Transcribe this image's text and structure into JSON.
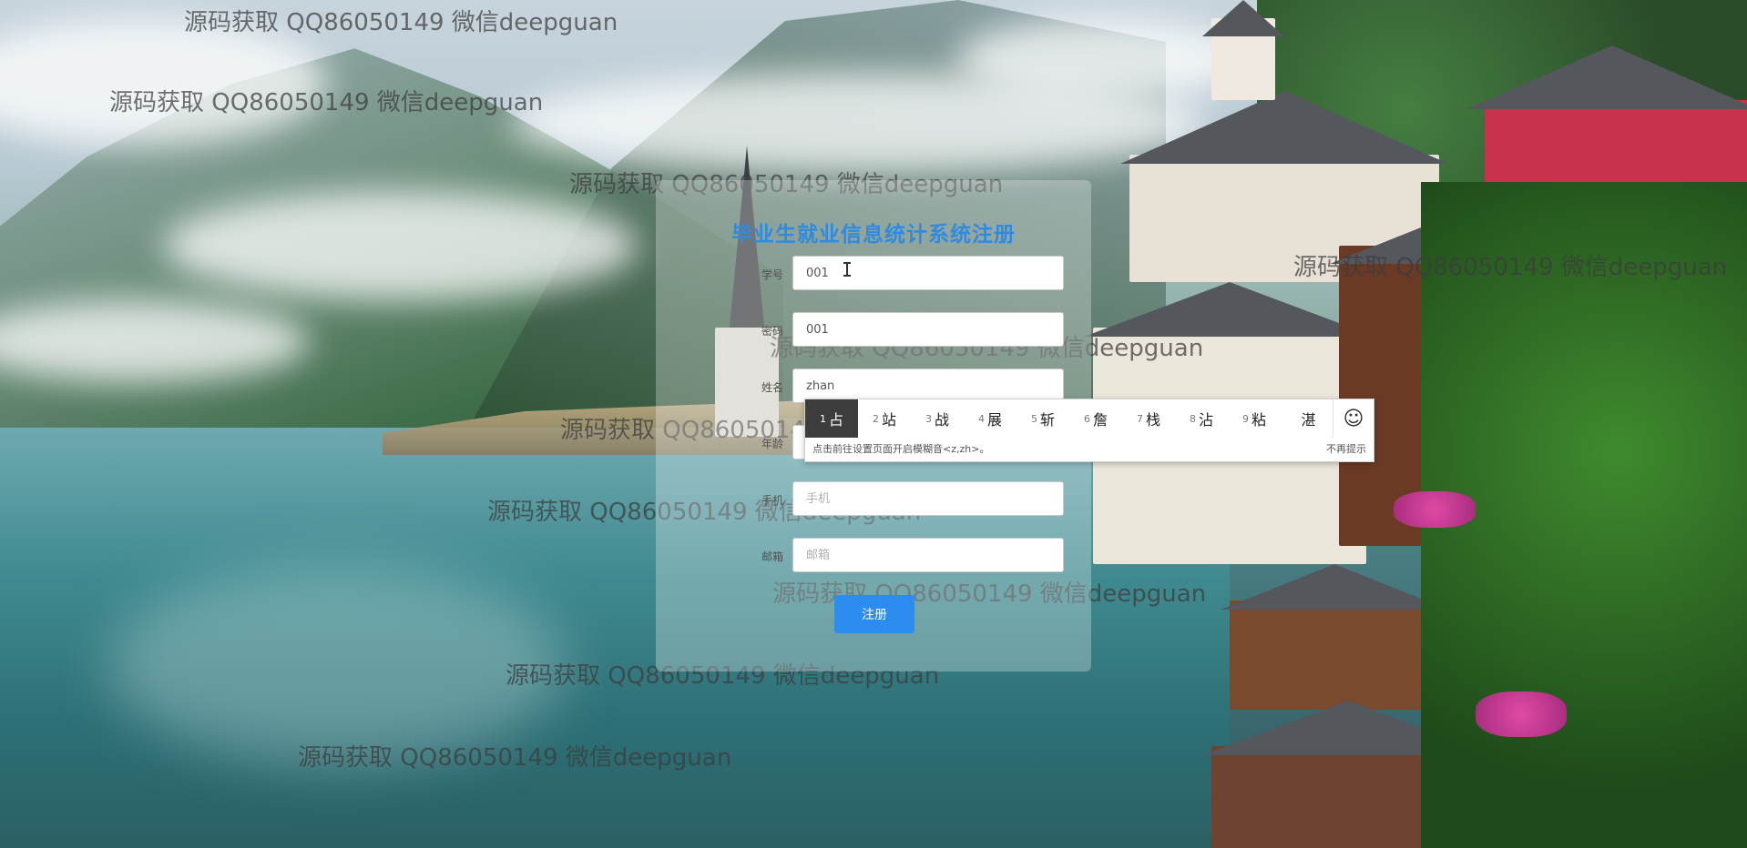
{
  "watermarks": [
    "源码获取 QQ86050149 微信deepguan",
    "源码获取 QQ86050149 微信deepguan",
    "源码获取 QQ86050149 微信deepguan",
    "源码获取 QQ86050149 微信deepguan",
    "源码获取 QQ86050149 微信deepguan",
    "源码获取 QQ86050149 微信deepguan",
    "源码获取 QQ86050149 微信deepguan",
    "源码获取 QQ86050149 微信deepguan",
    "源码获取 QQ86050149 微信deepguan",
    "源码获取 QQ86050149 微信deepguan"
  ],
  "form": {
    "title": "毕业生就业信息统计系统注册",
    "fields": [
      {
        "label": "学号",
        "value": "001",
        "placeholder": ""
      },
      {
        "label": "密码",
        "value": "001",
        "placeholder": ""
      },
      {
        "label": "姓名",
        "value": "zhan",
        "placeholder": ""
      },
      {
        "label": "年龄",
        "value": "",
        "placeholder": ""
      },
      {
        "label": "手机",
        "value": "",
        "placeholder": "手机"
      },
      {
        "label": "邮箱",
        "value": "",
        "placeholder": "邮箱"
      }
    ],
    "submit_label": "注册"
  },
  "ime": {
    "candidates": [
      {
        "num": "1",
        "text": "占"
      },
      {
        "num": "2",
        "text": "站"
      },
      {
        "num": "3",
        "text": "战"
      },
      {
        "num": "4",
        "text": "展"
      },
      {
        "num": "5",
        "text": "斩"
      },
      {
        "num": "6",
        "text": "詹"
      },
      {
        "num": "7",
        "text": "栈"
      },
      {
        "num": "8",
        "text": "沾"
      },
      {
        "num": "9",
        "text": "粘"
      },
      {
        "num": "",
        "text": "湛"
      }
    ],
    "emoji_icon": "☺",
    "hint": "点击前往设置页面开启模糊音<z,zh>。",
    "dismiss_label": "不再提示"
  },
  "colors": {
    "accent": "#2d8cf0",
    "title": "#2e8bdf",
    "ime_selected": "#3d3d3d"
  }
}
